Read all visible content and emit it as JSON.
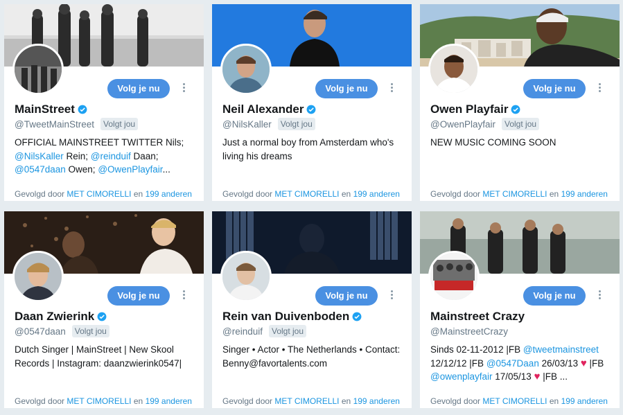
{
  "follow_label": "Volg je nu",
  "follows_you_label": "Volgt jou",
  "followed_by": {
    "prefix": "Gevolgd door",
    "user": "MET CIMORELLI",
    "middle": "en",
    "others": "199 anderen"
  },
  "colors": {
    "accent": "#4a90e2",
    "link": "#1b95e0",
    "verified": "#1da1f2",
    "heart": "#e0245e",
    "background": "#e6ecf0"
  },
  "cards": [
    {
      "name": "MainStreet",
      "verified": true,
      "handle": "@TweetMainStreet",
      "follows_you": true,
      "bio": [
        {
          "t": "OFFICIAL MAINSTREET TWITTER Nils; "
        },
        {
          "t": "@NilsKaller",
          "link": true
        },
        {
          "t": " Rein; "
        },
        {
          "t": "@reinduif",
          "link": true
        },
        {
          "t": " Daan; "
        },
        {
          "t": "@0547daan",
          "link": true
        },
        {
          "t": " Owen; "
        },
        {
          "t": "@OwenPlayfair",
          "link": true
        },
        {
          "t": "..."
        }
      ]
    },
    {
      "name": "Neil Alexander",
      "verified": true,
      "handle": "@NilsKaller",
      "follows_you": true,
      "bio": [
        {
          "t": "Just a normal boy from Amsterdam who's living his dreams"
        }
      ]
    },
    {
      "name": "Owen Playfair",
      "verified": true,
      "handle": "@OwenPlayfair",
      "follows_you": true,
      "bio": [
        {
          "t": "NEW MUSIC COMING SOON"
        }
      ]
    },
    {
      "name": "Daan Zwierink",
      "verified": true,
      "handle": "@0547daan",
      "follows_you": true,
      "bio": [
        {
          "t": "Dutch Singer | MainStreet | New Skool Records | Instagram: daanzwierink0547|"
        }
      ]
    },
    {
      "name": "Rein van Duivenboden",
      "verified": true,
      "handle": "@reinduif",
      "follows_you": true,
      "bio": [
        {
          "t": "Singer • Actor • The Netherlands • Contact: Benny@favortalents.com"
        }
      ]
    },
    {
      "name": "Mainstreet Crazy",
      "verified": false,
      "handle": "@MainstreetCrazy",
      "follows_you": false,
      "bio": [
        {
          "t": "Sinds 02-11-2012 |FB "
        },
        {
          "t": "@tweetmainstreet",
          "link": true
        },
        {
          "t": " 12/12/12 |FB "
        },
        {
          "t": "@0547Daan",
          "link": true
        },
        {
          "t": " 26/03/13 "
        },
        {
          "t": "♥",
          "heart": true
        },
        {
          "t": " |FB "
        },
        {
          "t": "@owenplayfair",
          "link": true
        },
        {
          "t": " 17/05/13 "
        },
        {
          "t": "♥",
          "heart": true
        },
        {
          "t": " |FB ..."
        }
      ]
    }
  ]
}
